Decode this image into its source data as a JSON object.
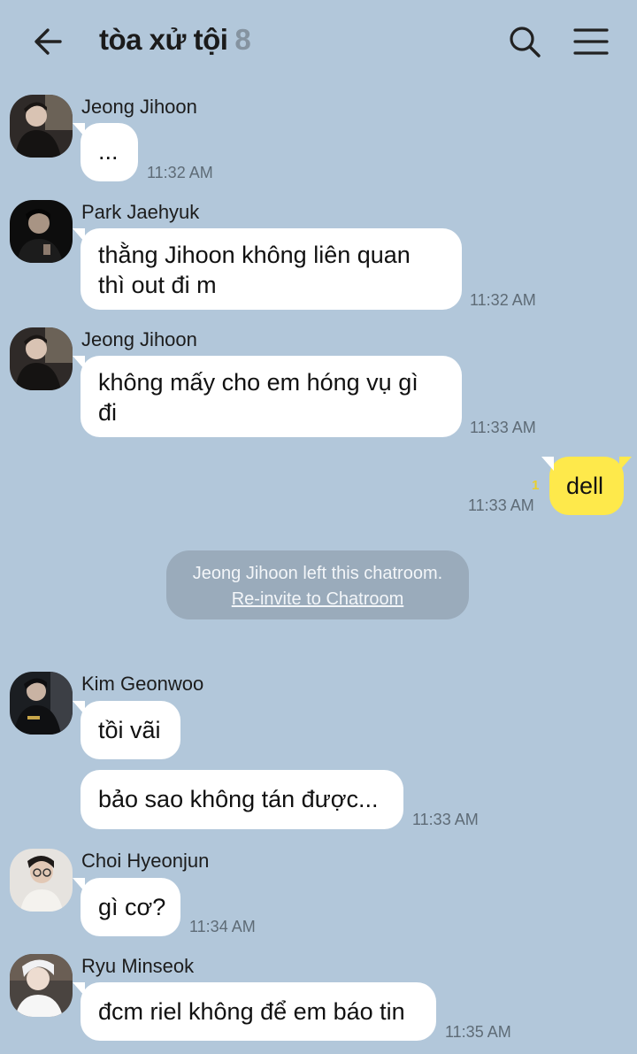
{
  "header": {
    "title": "tòa xử tội",
    "member_count": "8",
    "icons": {
      "back": "arrow-left-icon",
      "search": "search-icon",
      "menu": "hamburger-menu-icon"
    }
  },
  "messages": [
    {
      "sender": "Jeong Jihoon",
      "text": "...",
      "time": "11:32 AM"
    },
    {
      "sender": "Park Jaehyuk",
      "text": "thằng Jihoon không liên quan\nthì out đi m",
      "time": "11:32 AM"
    },
    {
      "sender": "Jeong Jihoon",
      "text": "không mấy cho em hóng vụ gì\nđi",
      "time": "11:33 AM"
    },
    {
      "sender": "me",
      "text": "dell",
      "time": "11:33 AM",
      "unread": "1"
    },
    {
      "sender": "Kim Geonwoo",
      "text": "tồi vãi",
      "time": ""
    },
    {
      "sender": "Kim Geonwoo",
      "text": "bảo sao không tán được...",
      "time": "11:33 AM"
    },
    {
      "sender": "Choi Hyeonjun",
      "text": "gì cơ?",
      "time": "11:34 AM"
    },
    {
      "sender": "Ryu Minseok",
      "text": "đcm riel không để em báo tin",
      "time": "11:35 AM"
    }
  ],
  "system_notice": {
    "text": "Jeong Jihoon left this chatroom.",
    "action": "Re-invite to Chatroom"
  },
  "colors": {
    "background": "#b2c7da",
    "bubble_other": "#ffffff",
    "bubble_mine": "#fee94b",
    "system_bg": "#9aabbb",
    "member_count": "#8593a0"
  }
}
